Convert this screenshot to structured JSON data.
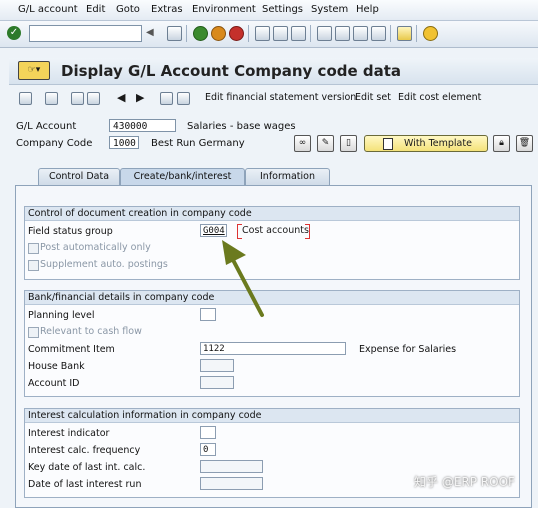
{
  "menu": [
    "G/L account",
    "Edit",
    "Goto",
    "Extras",
    "Environment",
    "Settings",
    "System",
    "Help"
  ],
  "std_toolbar": {
    "command_field": "",
    "icons": [
      "back-icon",
      "save-icon",
      "exit-icon",
      "cancel-icon",
      "print-icon",
      "find-icon",
      "find-next-icon",
      "first-page-icon",
      "prev-page-icon",
      "next-page-icon",
      "last-page-icon",
      "new-session-icon",
      "shortcut-icon",
      "help-icon"
    ]
  },
  "title": "Display G/L Account Company code data",
  "app_toolbar": {
    "buttons": [
      "Edit financial statement version",
      "Edit set",
      "Edit cost element"
    ]
  },
  "header": {
    "gl_account_label": "G/L Account",
    "gl_account_value": "430000",
    "gl_account_desc": "Salaries - base wages",
    "company_code_label": "Company Code",
    "company_code_value": "1000",
    "company_code_desc": "Best Run Germany",
    "with_template_label": "With Template"
  },
  "tabs": [
    "Control Data",
    "Create/bank/interest",
    "Information"
  ],
  "active_tab": "Create/bank/interest",
  "groups": {
    "doc_control": {
      "title": "Control of document creation in company code",
      "field_status_group_label": "Field status group",
      "field_status_group_value": "G004",
      "field_status_group_desc": "Cost accounts",
      "post_auto_label": "Post automatically only",
      "supplement_label": "Supplement auto. postings"
    },
    "bank": {
      "title": "Bank/financial details in company code",
      "planning_level_label": "Planning level",
      "planning_level_value": "",
      "relevant_cash_label": "Relevant to cash flow",
      "commitment_item_label": "Commitment Item",
      "commitment_item_value": "1122",
      "commitment_item_desc": "Expense for Salaries",
      "house_bank_label": "House Bank",
      "account_id_label": "Account ID"
    },
    "interest": {
      "title": "Interest calculation information in company code",
      "interest_indicator_label": "Interest indicator",
      "calc_frequency_label": "Interest calc. frequency",
      "calc_frequency_value": "0",
      "key_date_label": "Key date of last int. calc.",
      "last_run_label": "Date of last interest run"
    }
  },
  "watermark": "知乎 @ERP ROOF",
  "colors": {
    "arrow": "#6b7a1e",
    "required_bracket": "#dd3333",
    "template_button": "#f4e27a"
  }
}
